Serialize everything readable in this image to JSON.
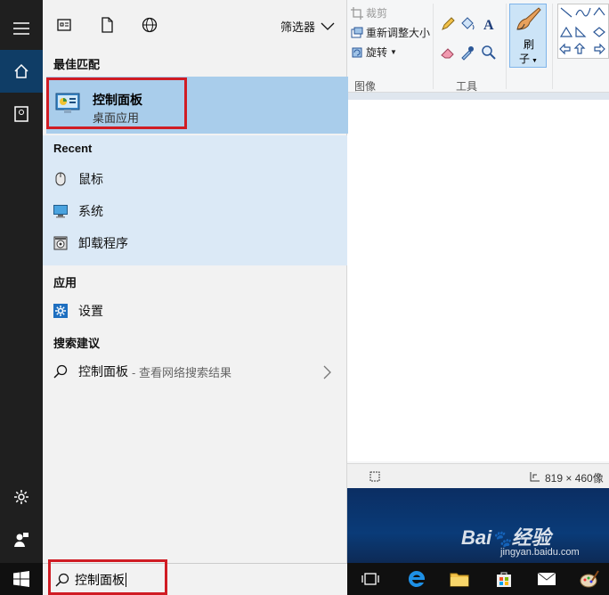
{
  "paint": {
    "ribbon": {
      "crop": "裁剪",
      "resize": "重新调整大小",
      "rotate": "旋转",
      "group_image": "图像",
      "group_tools": "工具",
      "brush_line1": "刷",
      "brush_line2": "子"
    },
    "statusbar": {
      "dimensions": "819 × 460像"
    }
  },
  "watermark": {
    "brand": "Bai",
    "brand2": "经验",
    "url": "jingyan.baidu.com"
  },
  "start_menu": {
    "filter_label": "筛选器",
    "best_match": {
      "header": "最佳匹配",
      "title": "控制面板",
      "subtitle": "桌面应用"
    },
    "recent": {
      "header": "Recent",
      "items": [
        {
          "label": "鼠标",
          "icon": "mouse-icon"
        },
        {
          "label": "系统",
          "icon": "monitor-icon"
        },
        {
          "label": "卸载程序",
          "icon": "uninstall-icon"
        }
      ]
    },
    "apps": {
      "header": "应用",
      "items": [
        {
          "label": "设置",
          "icon": "settings-app-icon"
        }
      ]
    },
    "suggestions": {
      "header": "搜索建议",
      "items": [
        {
          "label": "控制面板",
          "sub": "- 查看网络搜索结果",
          "icon": "search-icon"
        }
      ]
    }
  },
  "taskbar": {
    "search_value": "控制面板",
    "apps": [
      "task-view-icon",
      "edge-icon",
      "file-explorer-icon",
      "store-icon",
      "mail-icon",
      "paint-icon"
    ]
  },
  "colors": {
    "accent": "#0f3d66",
    "highlight": "#a9cdeb",
    "recent_bg": "#dbe9f6",
    "annotation": "#d01c24"
  }
}
